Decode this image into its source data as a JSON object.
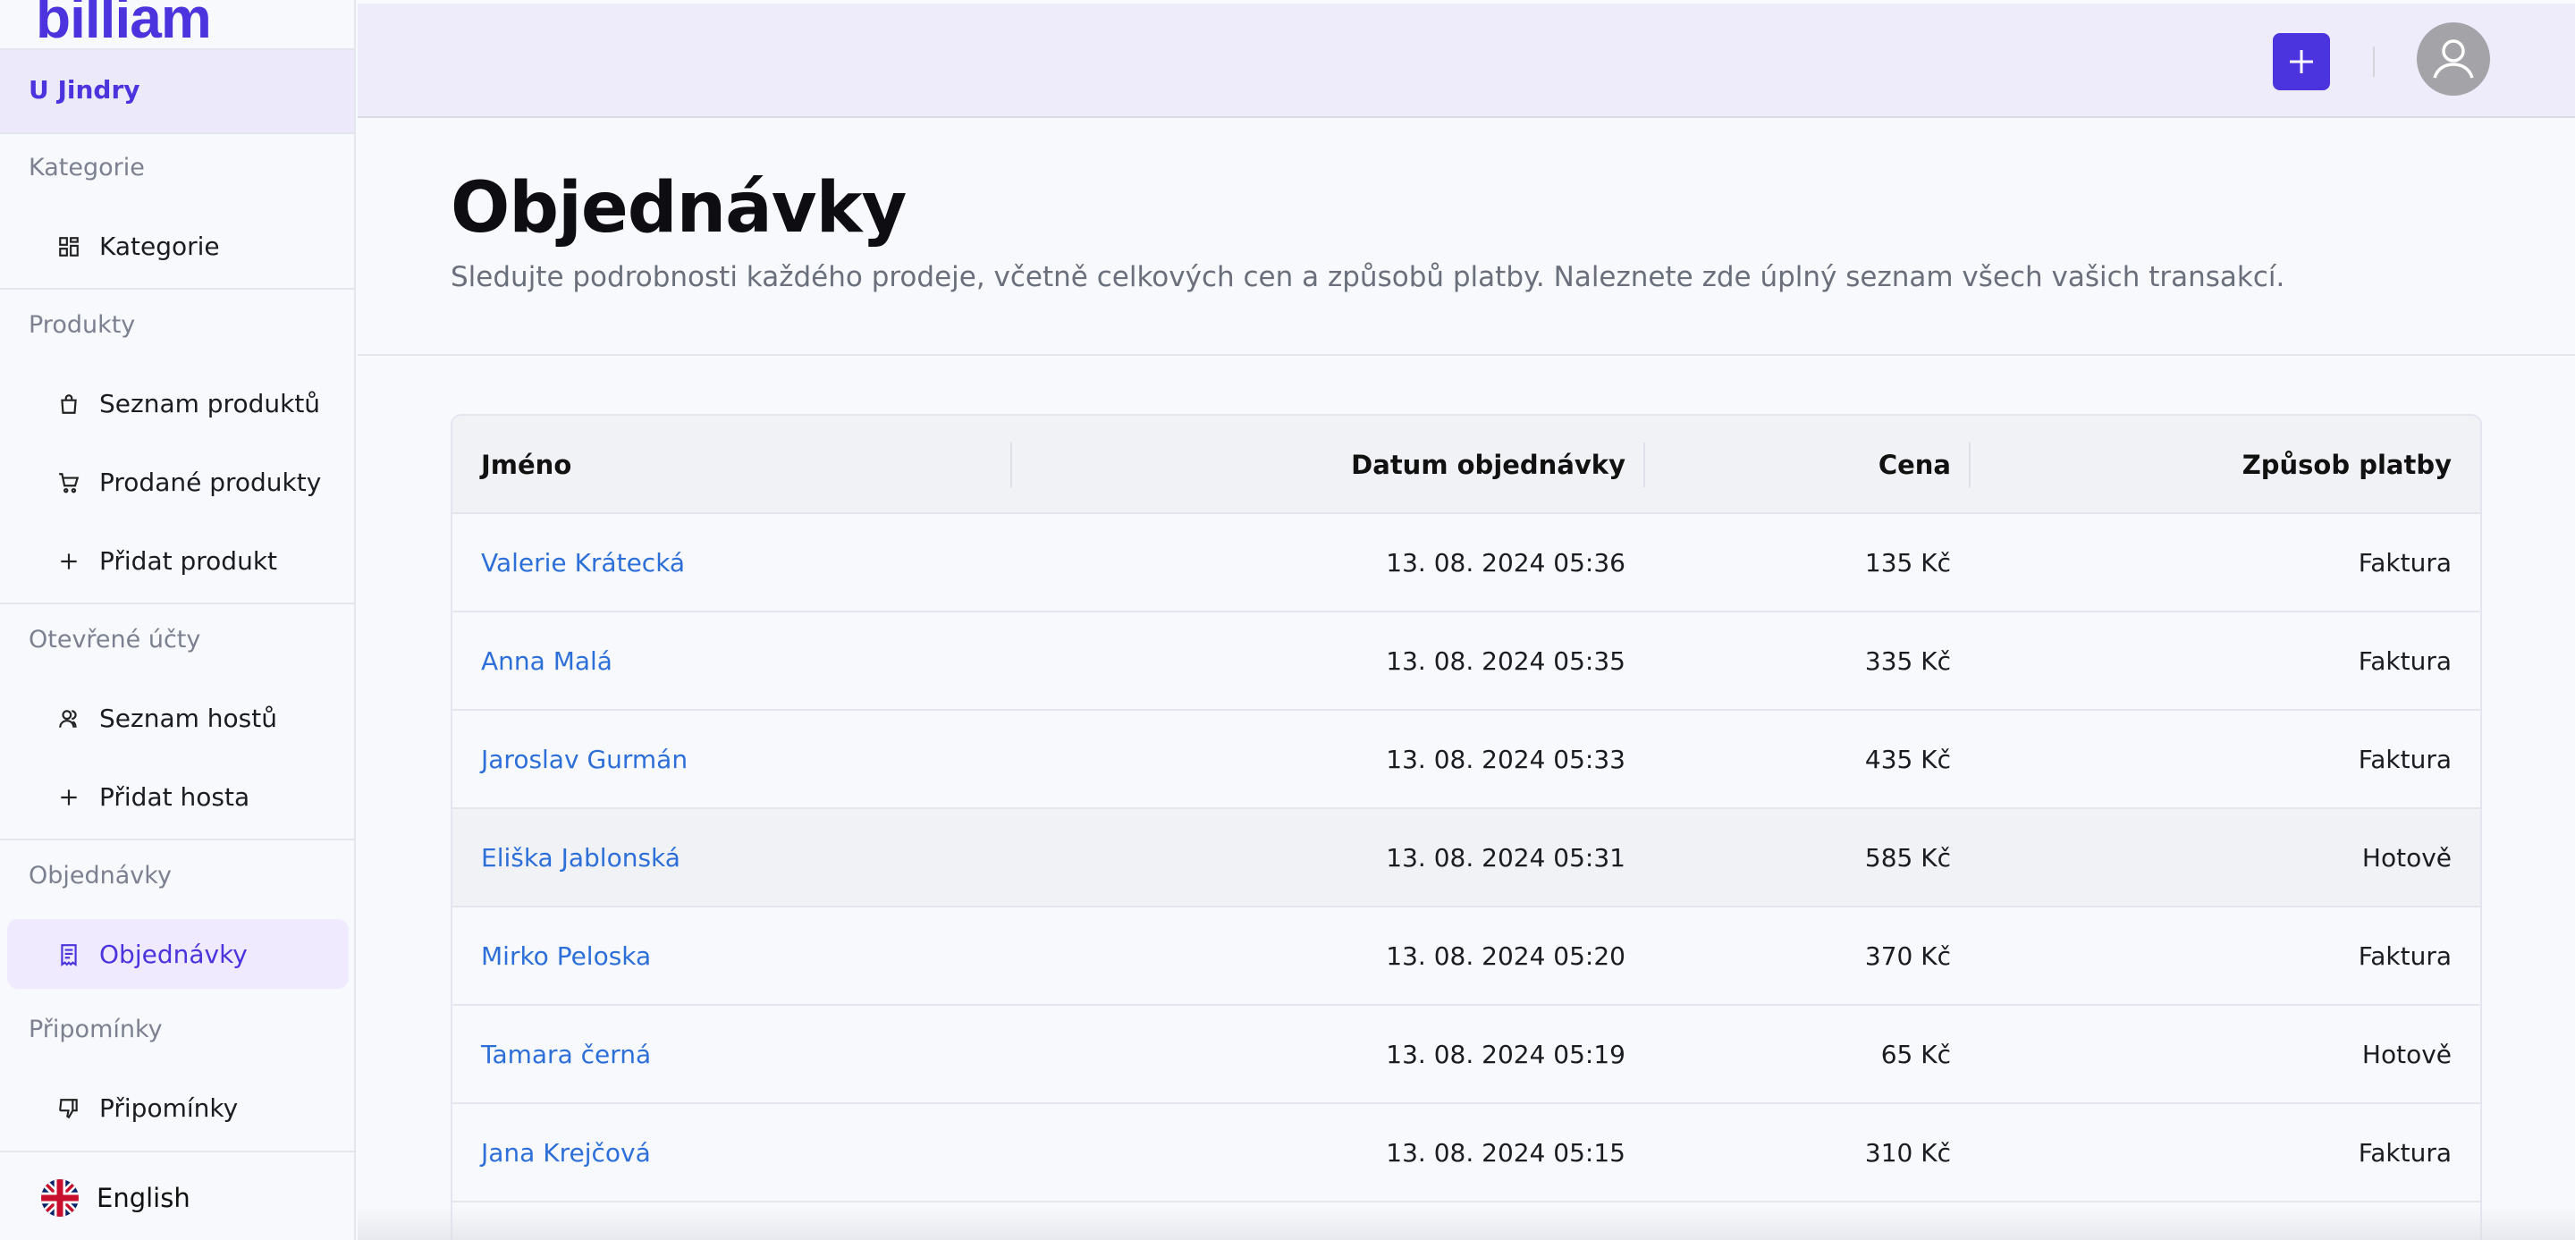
{
  "brand": {
    "logo_text": "billiam",
    "accent": "#4b34de"
  },
  "workspace": "U Jindry",
  "sidebar": {
    "sections": [
      {
        "title": "Kategorie",
        "items": [
          {
            "label": "Kategorie",
            "icon": "grid-icon"
          }
        ]
      },
      {
        "title": "Produkty",
        "items": [
          {
            "label": "Seznam produktů",
            "icon": "bag-icon"
          },
          {
            "label": "Prodané produkty",
            "icon": "cart-icon"
          },
          {
            "label": "Přidat produkt",
            "icon": "plus-icon"
          }
        ]
      },
      {
        "title": "Otevřené účty",
        "items": [
          {
            "label": "Seznam hostů",
            "icon": "users-icon"
          },
          {
            "label": "Přidat hosta",
            "icon": "plus-icon"
          }
        ]
      },
      {
        "title": "Objednávky",
        "items": [
          {
            "label": "Objednávky",
            "icon": "receipt-icon",
            "active": true
          }
        ]
      },
      {
        "title": "Připomínky",
        "items": [
          {
            "label": "Připomínky",
            "icon": "thumbs-down-icon"
          }
        ]
      }
    ],
    "language": {
      "label": "English",
      "icon": "uk-flag-icon"
    }
  },
  "topbar": {
    "add_icon": "plus-icon",
    "profile_icon": "user-icon"
  },
  "page": {
    "title": "Objednávky",
    "description": "Sledujte podrobnosti každého prodeje, včetně celkových cen a způsobů platby. Naleznete zde úplný seznam všech vašich transakcí."
  },
  "table": {
    "columns": [
      "Jméno",
      "Datum objednávky",
      "Cena",
      "Způsob platby"
    ],
    "rows": [
      {
        "name": "Valerie Krátecká",
        "date": "13. 08. 2024 05:36",
        "price": "135 Kč",
        "payment": "Faktura"
      },
      {
        "name": "Anna Malá",
        "date": "13. 08. 2024 05:35",
        "price": "335 Kč",
        "payment": "Faktura"
      },
      {
        "name": "Jaroslav Gurmán",
        "date": "13. 08. 2024 05:33",
        "price": "435 Kč",
        "payment": "Faktura"
      },
      {
        "name": "Eliška Jablonská",
        "date": "13. 08. 2024 05:31",
        "price": "585 Kč",
        "payment": "Hotově"
      },
      {
        "name": "Mirko Peloska",
        "date": "13. 08. 2024 05:20",
        "price": "370 Kč",
        "payment": "Faktura"
      },
      {
        "name": "Tamara černá",
        "date": "13. 08. 2024 05:19",
        "price": "65 Kč",
        "payment": "Hotově"
      },
      {
        "name": "Jana Krejčová",
        "date": "13. 08. 2024 05:15",
        "price": "310 Kč",
        "payment": "Faktura"
      }
    ]
  }
}
